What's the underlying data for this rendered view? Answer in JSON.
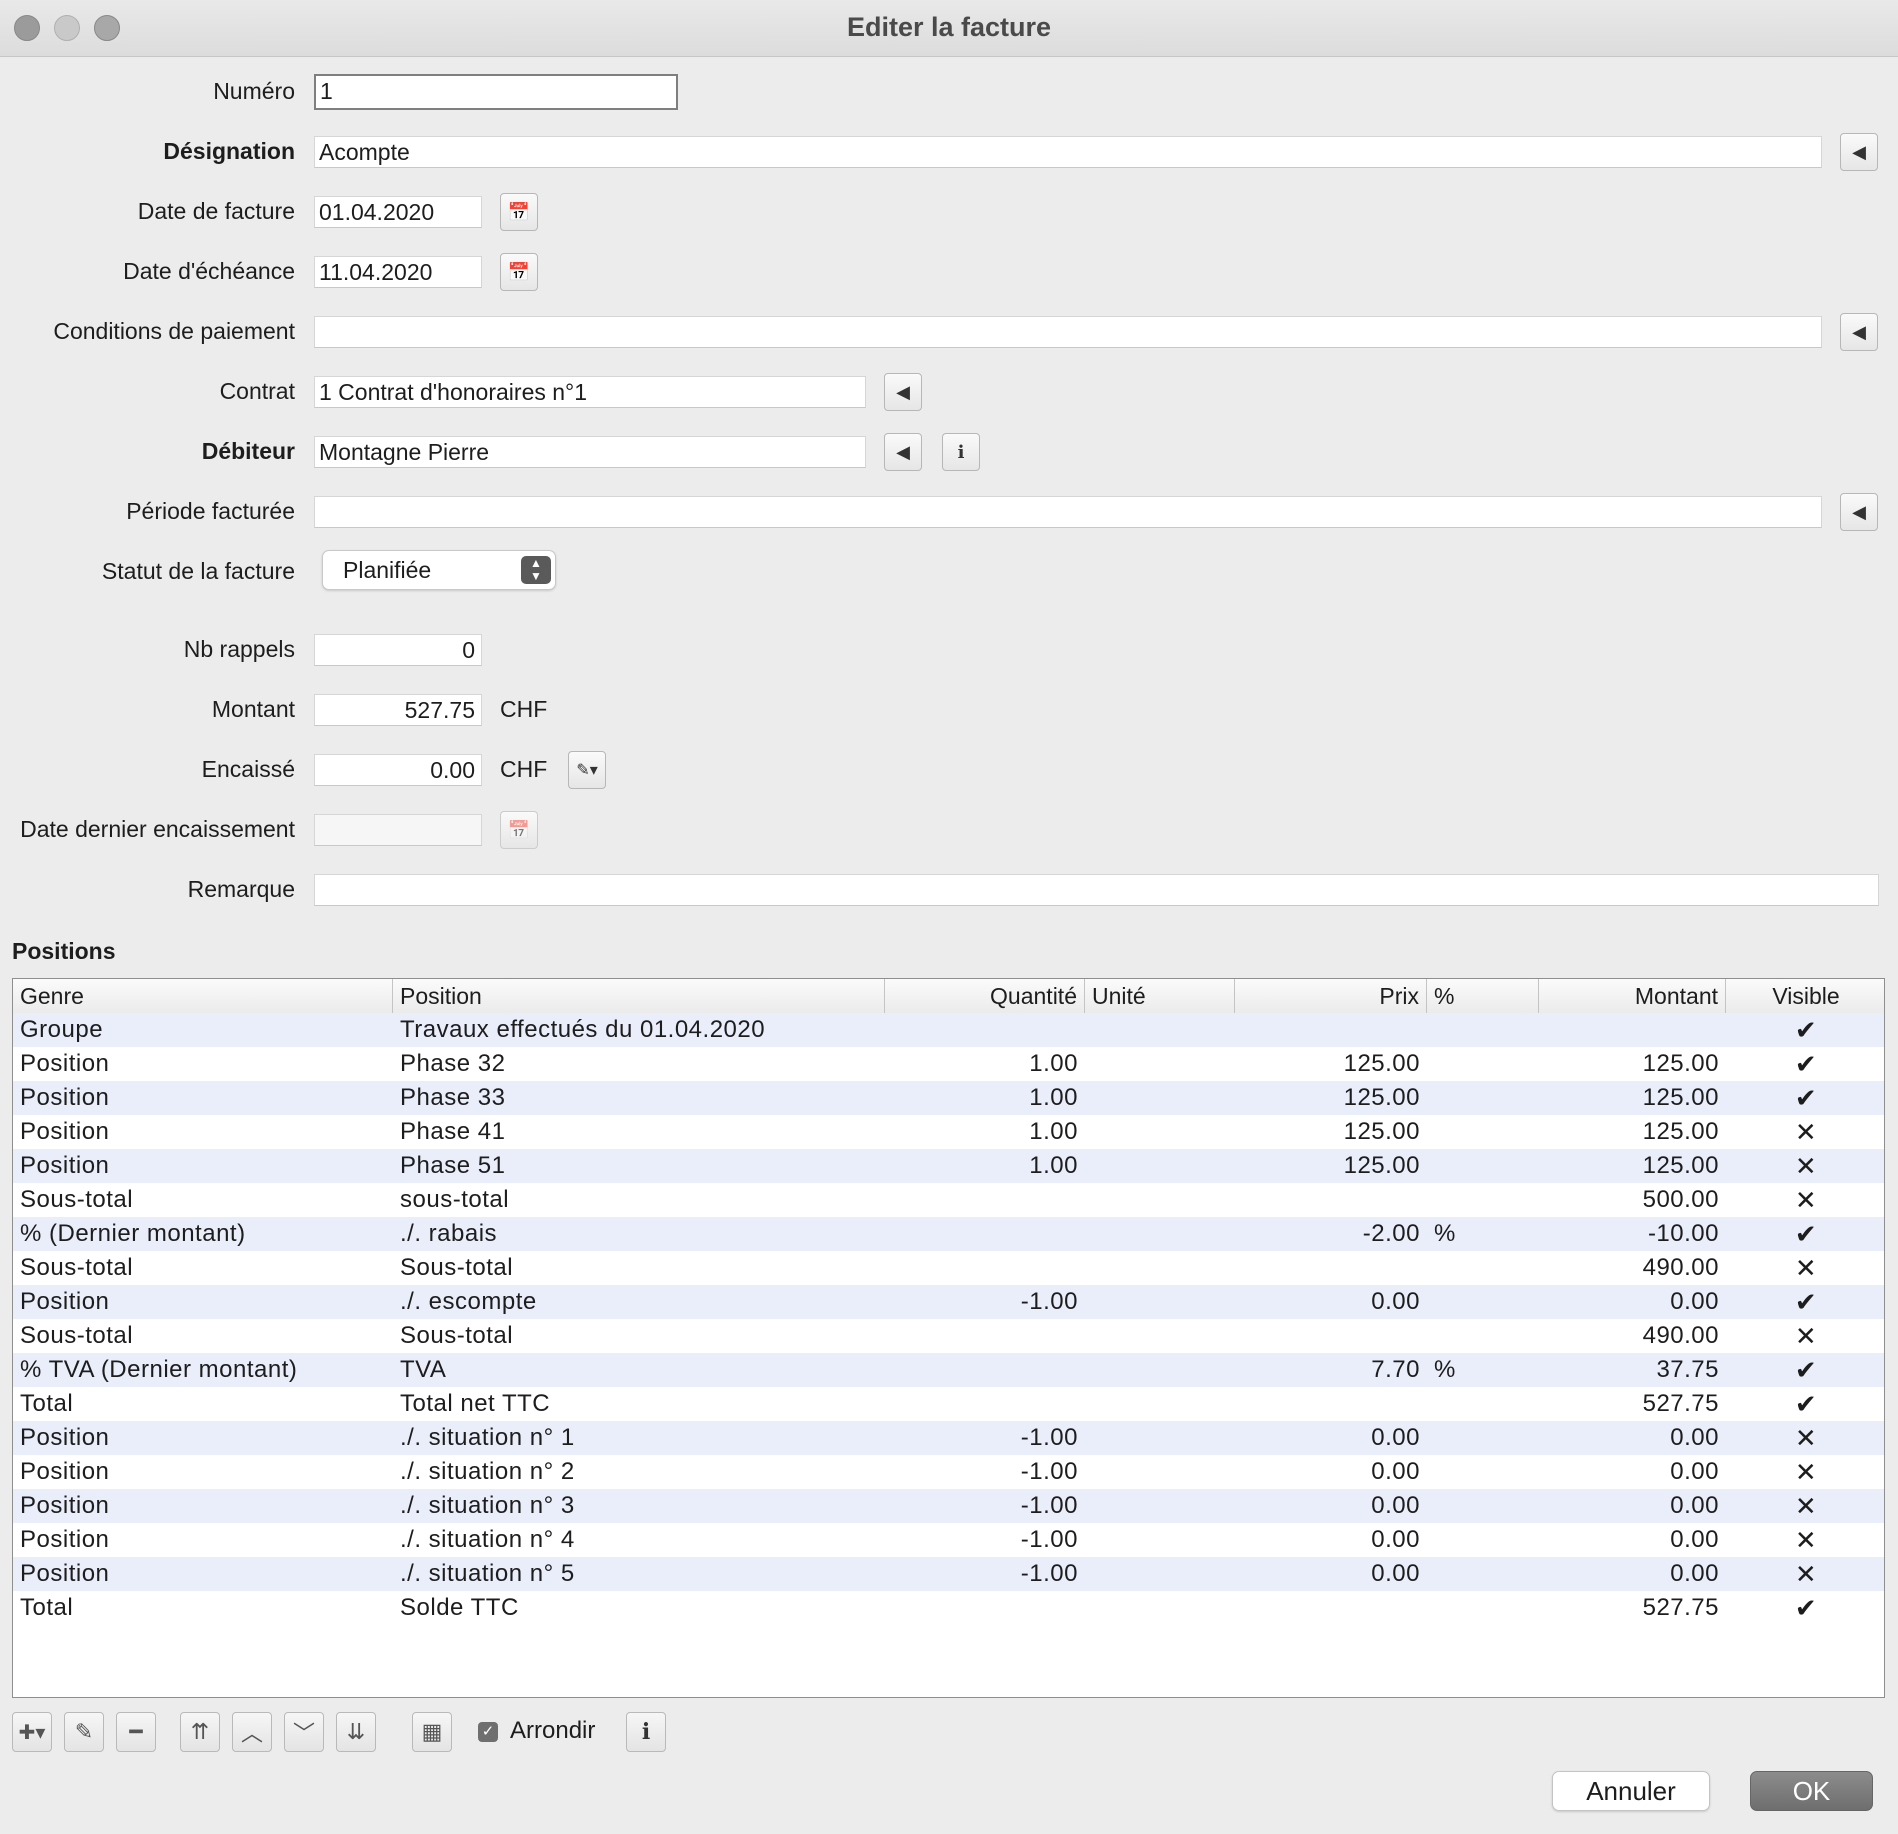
{
  "window": {
    "title": "Editer la facture"
  },
  "form": {
    "numero": {
      "label": "Numéro",
      "value": "1"
    },
    "designation": {
      "label": "Désignation",
      "value": "Acompte"
    },
    "date_facture": {
      "label": "Date de facture",
      "value": "01.04.2020"
    },
    "date_echeance": {
      "label": "Date d'échéance",
      "value": "11.04.2020"
    },
    "conditions": {
      "label": "Conditions de paiement",
      "value": ""
    },
    "contrat": {
      "label": "Contrat",
      "value": "1 Contrat d'honoraires n°1"
    },
    "debiteur": {
      "label": "Débiteur",
      "value": "Montagne Pierre"
    },
    "periode": {
      "label": "Période facturée",
      "value": ""
    },
    "statut": {
      "label": "Statut de la facture",
      "value": "Planifiée"
    },
    "nb_rappels": {
      "label": "Nb rappels",
      "value": "0"
    },
    "montant": {
      "label": "Montant",
      "value": "527.75",
      "unit": "CHF"
    },
    "encaisse": {
      "label": "Encaissé",
      "value": "0.00",
      "unit": "CHF"
    },
    "date_dernier": {
      "label": "Date dernier encaissement",
      "value": ""
    },
    "remarque": {
      "label": "Remarque",
      "value": ""
    }
  },
  "positions": {
    "title": "Positions",
    "columns": [
      "Genre",
      "Position",
      "Quantité",
      "Unité",
      "Prix",
      "%",
      "Montant",
      "Visible"
    ],
    "rows": [
      [
        "Groupe",
        "Travaux effectués du 01.04.2020",
        "",
        "",
        "",
        "",
        "",
        "✔"
      ],
      [
        "Position",
        "Phase 32",
        "1.00",
        "",
        "125.00",
        "",
        "125.00",
        "✔"
      ],
      [
        "Position",
        "Phase 33",
        "1.00",
        "",
        "125.00",
        "",
        "125.00",
        "✔"
      ],
      [
        "Position",
        "Phase 41",
        "1.00",
        "",
        "125.00",
        "",
        "125.00",
        "✕"
      ],
      [
        "Position",
        "Phase 51",
        "1.00",
        "",
        "125.00",
        "",
        "125.00",
        "✕"
      ],
      [
        "Sous-total",
        "sous-total",
        "",
        "",
        "",
        "",
        "500.00",
        "✕"
      ],
      [
        "% (Dernier montant)",
        "./. rabais",
        "",
        "",
        "-2.00",
        "%",
        "-10.00",
        "✔"
      ],
      [
        "Sous-total",
        "Sous-total",
        "",
        "",
        "",
        "",
        "490.00",
        "✕"
      ],
      [
        "Position",
        "./. escompte",
        "-1.00",
        "",
        "0.00",
        "",
        "0.00",
        "✔"
      ],
      [
        "Sous-total",
        "Sous-total",
        "",
        "",
        "",
        "",
        "490.00",
        "✕"
      ],
      [
        "% TVA (Dernier montant)",
        "TVA",
        "",
        "",
        "7.70",
        "%",
        "37.75",
        "✔"
      ],
      [
        "Total",
        "Total net TTC",
        "",
        "",
        "",
        "",
        "527.75",
        "✔"
      ],
      [
        "Position",
        "./. situation n° 1",
        "-1.00",
        "",
        "0.00",
        "",
        "0.00",
        "✕"
      ],
      [
        "Position",
        "./. situation n° 2",
        "-1.00",
        "",
        "0.00",
        "",
        "0.00",
        "✕"
      ],
      [
        "Position",
        "./. situation n° 3",
        "-1.00",
        "",
        "0.00",
        "",
        "0.00",
        "✕"
      ],
      [
        "Position",
        "./. situation n° 4",
        "-1.00",
        "",
        "0.00",
        "",
        "0.00",
        "✕"
      ],
      [
        "Position",
        "./. situation n° 5",
        "-1.00",
        "",
        "0.00",
        "",
        "0.00",
        "✕"
      ],
      [
        "Total",
        "Solde TTC",
        "",
        "",
        "",
        "",
        "527.75",
        "✔"
      ]
    ]
  },
  "toolbar": {
    "arrondir_label": "Arrondir",
    "arrondir_checked": true
  },
  "buttons": {
    "cancel": "Annuler",
    "ok": "OK"
  },
  "icons": {
    "calendar": "calendar-icon",
    "back": "triangle-left-icon",
    "info": "info-icon",
    "edit": "pencil-icon"
  }
}
